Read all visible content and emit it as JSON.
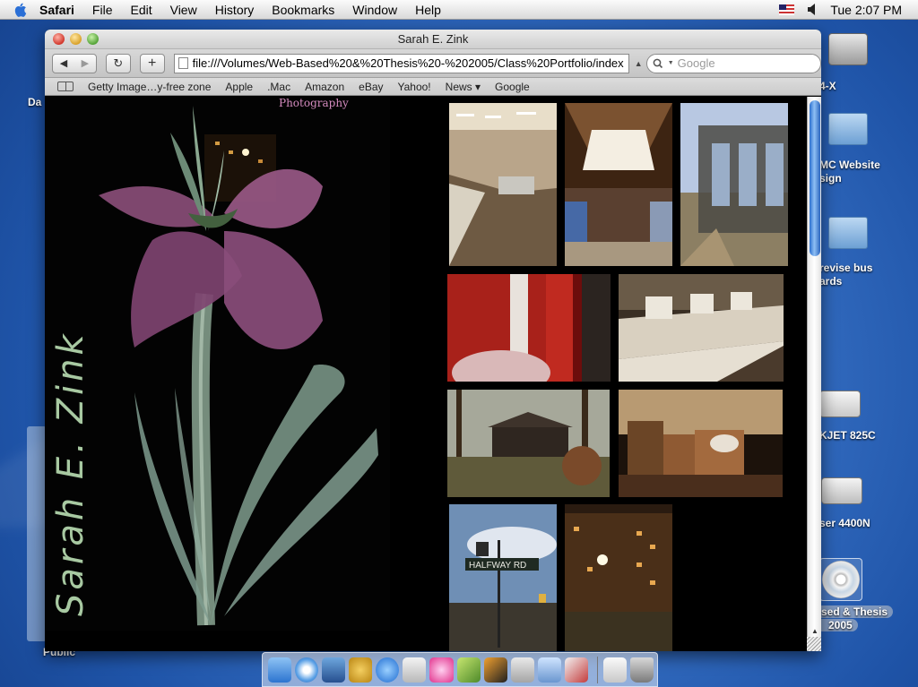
{
  "menubar": {
    "app": "Safari",
    "items": [
      "File",
      "Edit",
      "View",
      "History",
      "Bookmarks",
      "Window",
      "Help"
    ],
    "clock": "Tue 2:07 PM"
  },
  "desktop": {
    "icons": [
      {
        "label": "4-X",
        "kind": "drive-icon"
      },
      {
        "label": "MC Website",
        "label2": "sign",
        "kind": "folder-icon"
      },
      {
        "label": "revise bus",
        "label2": "ards",
        "kind": "folder-icon"
      },
      {
        "label": "KJET 825C",
        "kind": "printer-icon"
      },
      {
        "label": "ser 4400N",
        "kind": "printer-icon"
      },
      {
        "label": "sed & Thesis",
        "label2": "2005",
        "kind": "disc-icon"
      },
      {
        "label": "Da",
        "kind": "partial"
      },
      {
        "label": "Public",
        "kind": "partial"
      }
    ]
  },
  "window": {
    "title": "Sarah E. Zink",
    "toolbar": {
      "back": "◀",
      "forward": "▶",
      "reload": "↻",
      "add": "+",
      "url": "file:///Volumes/Web-Based%20&%20Thesis%20-%202005/Class%20Portfolio/index",
      "search_placeholder": "Google"
    },
    "bookmarks": [
      "Getty Image…y-free zone",
      "Apple",
      ".Mac",
      "Amazon",
      "eBay",
      "Yahoo!",
      "News ▾",
      "Google"
    ]
  },
  "page": {
    "nav_link": "Photography",
    "signature": "Sarah E. Zink",
    "thumbnails": [
      "computer lab",
      "atrium ceiling",
      "glass bus shelter",
      "red lockers",
      "printers on counter",
      "gazebo in woods",
      "booth seating",
      "Halfway Rd sign",
      "building at night"
    ],
    "street_sign": "HALFWAY RD"
  },
  "colors": {
    "desktop": "#2f66b8",
    "page_bg": "#000000",
    "link": "#d58bbf",
    "signature": "#a8c9a2",
    "scroll_accent": "#2b6fd0"
  }
}
